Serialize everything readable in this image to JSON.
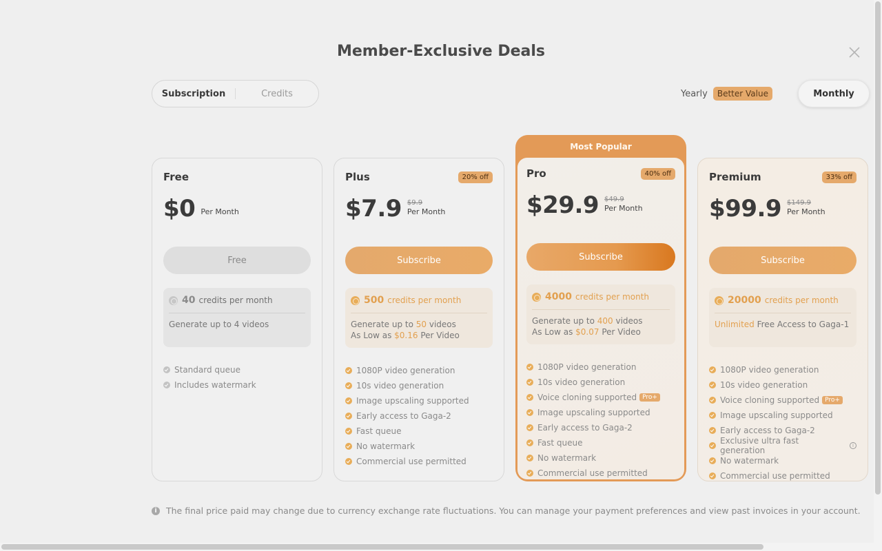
{
  "title": "Member-Exclusive Deals",
  "tabs": {
    "subscription": "Subscription",
    "credits": "Credits"
  },
  "billing": {
    "yearly": "Yearly",
    "better_value": "Better Value",
    "monthly": "Monthly"
  },
  "plans": [
    {
      "name": "Free",
      "price": "$0",
      "old_price": "",
      "per": "Per Month",
      "badge": "",
      "cta": "Free",
      "credits_num": "40",
      "credits_label": "credits per month",
      "gen_line1_pre": "Generate up to 4 videos",
      "gen_line1_hl": "",
      "gen_line1_post": "",
      "features": [
        "Standard queue",
        "Includes watermark"
      ]
    },
    {
      "name": "Plus",
      "price": "$7.9",
      "old_price": "$9.9",
      "per": "Per Month",
      "badge": "20% off",
      "cta": "Subscribe",
      "credits_num": "500",
      "credits_label": "credits per month",
      "gen_line1_pre": "Generate up to ",
      "gen_line1_hl": "50",
      "gen_line1_post": " videos",
      "gen_line2_pre": "As Low as ",
      "gen_line2_hl": "$0.16",
      "gen_line2_post": " Per Video",
      "features": [
        "1080P video generation",
        "10s video generation",
        "Image upscaling supported",
        "Early access to Gaga-2",
        "Fast queue",
        "No watermark",
        "Commercial use permitted"
      ]
    },
    {
      "banner": "Most Popular",
      "name": "Pro",
      "price": "$29.9",
      "old_price": "$49.9",
      "per": "Per Month",
      "badge": "40% off",
      "cta": "Subscribe",
      "credits_num": "4000",
      "credits_label": "credits per month",
      "gen_line1_pre": "Generate up to ",
      "gen_line1_hl": "400",
      "gen_line1_post": " videos",
      "gen_line2_pre": "As Low as ",
      "gen_line2_hl": "$0.07",
      "gen_line2_post": " Per Video",
      "features": [
        "1080P video generation",
        "10s video generation",
        "Voice cloning supported",
        "Image upscaling supported",
        "Early access to Gaga-2",
        "Fast queue",
        "No watermark",
        "Commercial use permitted"
      ],
      "pro_plus": "Pro+"
    },
    {
      "name": "Premium",
      "price": "$99.9",
      "old_price": "$149.9",
      "per": "Per Month",
      "badge": "33% off",
      "cta": "Subscribe",
      "credits_num": "20000",
      "credits_label": "credits per month",
      "gen_line1_hl": "Unlimited",
      "gen_line1_post": " Free Access to Gaga-1",
      "features": [
        "1080P video generation",
        "10s video generation",
        "Voice cloning supported",
        "Image upscaling supported",
        "Early access to Gaga-2",
        "Exclusive ultra fast generation",
        "No watermark",
        "Commercial use permitted"
      ],
      "pro_plus": "Pro+"
    }
  ],
  "footer": "The final price paid may change due to currency exchange rate fluctuations. You can manage your payment preferences and view past invoices in your account.",
  "colors": {
    "accent": "#e5a96b",
    "accent_dark": "#d9781f",
    "background": "#efefef"
  },
  "icons": {
    "close": "close-icon",
    "info": "info-icon",
    "coin": "coin-icon",
    "check": "check-icon"
  }
}
